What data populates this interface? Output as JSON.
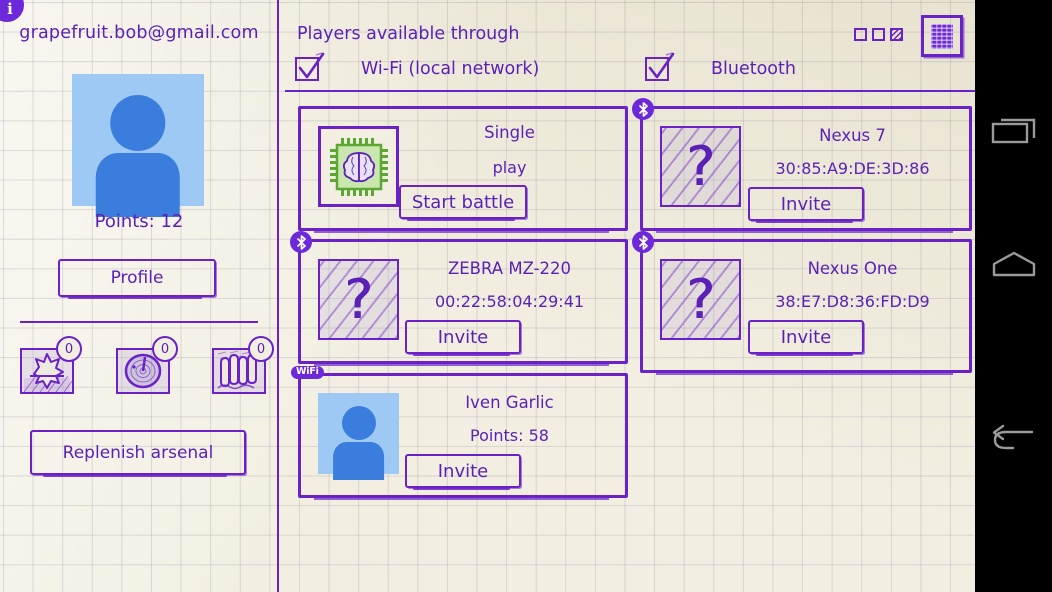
{
  "app": {
    "info_badge": "i"
  },
  "sidebar": {
    "account_email": "grapefruit.bob@gmail.com",
    "avatar_name": "avatar-placeholder",
    "points_label": "Points: 12",
    "profile_button": "Profile",
    "replenish_button": "Replenish arsenal",
    "arsenal": [
      {
        "name": "bomb-item",
        "icon": "explosion-icon",
        "count": "0"
      },
      {
        "name": "radar-item",
        "icon": "radar-icon",
        "count": "0"
      },
      {
        "name": "rocket-item",
        "icon": "rockets-icon",
        "count": "0"
      }
    ]
  },
  "header": {
    "title": "Players available through",
    "wifi_label": "Wi-Fi (local network)",
    "wifi_checked": true,
    "bluetooth_label": "Bluetooth",
    "bluetooth_checked": true,
    "mini_icons": [
      "square-icon",
      "square-icon",
      "hatched-square-icon"
    ],
    "qr_button": "qr-code-icon"
  },
  "cards": [
    {
      "id": "single-play",
      "thumb": "ai-chip-brain-icon",
      "badge": null,
      "name": "Single",
      "sub": "play",
      "button": "Start battle"
    },
    {
      "id": "nexus-7",
      "thumb": "unknown-player-icon",
      "badge": "bluetooth",
      "name": "Nexus 7",
      "sub": "30:85:A9:DE:3D:86",
      "button": "Invite"
    },
    {
      "id": "zebra-mz-220",
      "thumb": "unknown-player-icon",
      "badge": "bluetooth",
      "name": "ZEBRA MZ-220",
      "sub": "00:22:58:04:29:41",
      "button": "Invite"
    },
    {
      "id": "nexus-one",
      "thumb": "unknown-player-icon",
      "badge": "bluetooth",
      "name": "Nexus One",
      "sub": "38:E7:D8:36:FD:D9",
      "button": "Invite"
    },
    {
      "id": "iven-garlic",
      "thumb": "avatar-placeholder",
      "badge": "wifi",
      "badge_text": "WiFi",
      "name": "Iven Garlic",
      "sub": "Points: 58",
      "button": "Invite"
    }
  ],
  "navbar": {
    "recents": "recents-icon",
    "home": "home-icon",
    "back": "back-icon"
  },
  "colors": {
    "ink": "#5b21b6",
    "ink_strong": "#6b21c8",
    "paper": "#f2efe2",
    "avatar_bg": "#9ec9f5",
    "avatar_fg": "#3b7ddd",
    "ai_green": "#5aa832",
    "navbar": "#000000"
  }
}
